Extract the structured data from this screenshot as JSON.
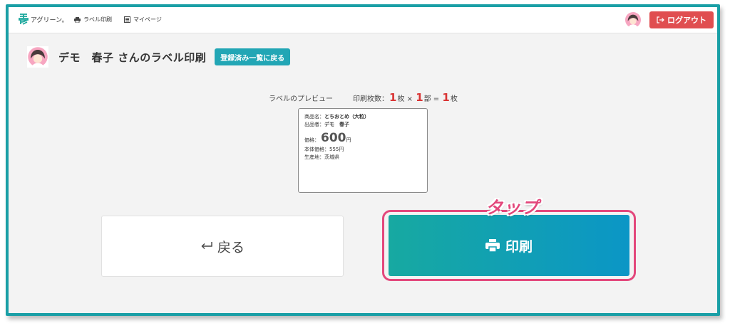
{
  "header": {
    "logo_text": "アグリーン。",
    "nav": [
      {
        "label": "ラベル印刷",
        "icon": "printer-icon"
      },
      {
        "label": "マイページ",
        "icon": "id-card-icon"
      }
    ],
    "logout_label": "ログアウト"
  },
  "page": {
    "title": "デモ　春子 さんのラベル印刷",
    "back_list_label": "登録済み一覧に戻る"
  },
  "preview": {
    "label": "ラベルのプレビュー",
    "count_prefix": "印刷枚数：",
    "sheets": "1",
    "sheets_unit": "枚",
    "times": " × ",
    "copies": "1",
    "copies_unit": "部",
    "equals": " = ",
    "total": "1",
    "total_unit": "枚"
  },
  "label_card": {
    "product_key": "商品名：",
    "product_value": "とちおとめ（大粒）",
    "seller_key": "出品者：",
    "seller_value": "デモ　春子",
    "price_key": "価格：",
    "price_value": "600",
    "price_unit": "円",
    "base_price": "本体価格：555円",
    "origin": "生産地：茨城県"
  },
  "actions": {
    "back_label": "戻る",
    "print_label": "印刷",
    "tap_annotation": "タップ"
  },
  "colors": {
    "frame": "#1a9fa6",
    "logout": "#e04e50",
    "accent": "#22a6b5",
    "highlight": "#e3487c",
    "count_number": "#d93434"
  }
}
